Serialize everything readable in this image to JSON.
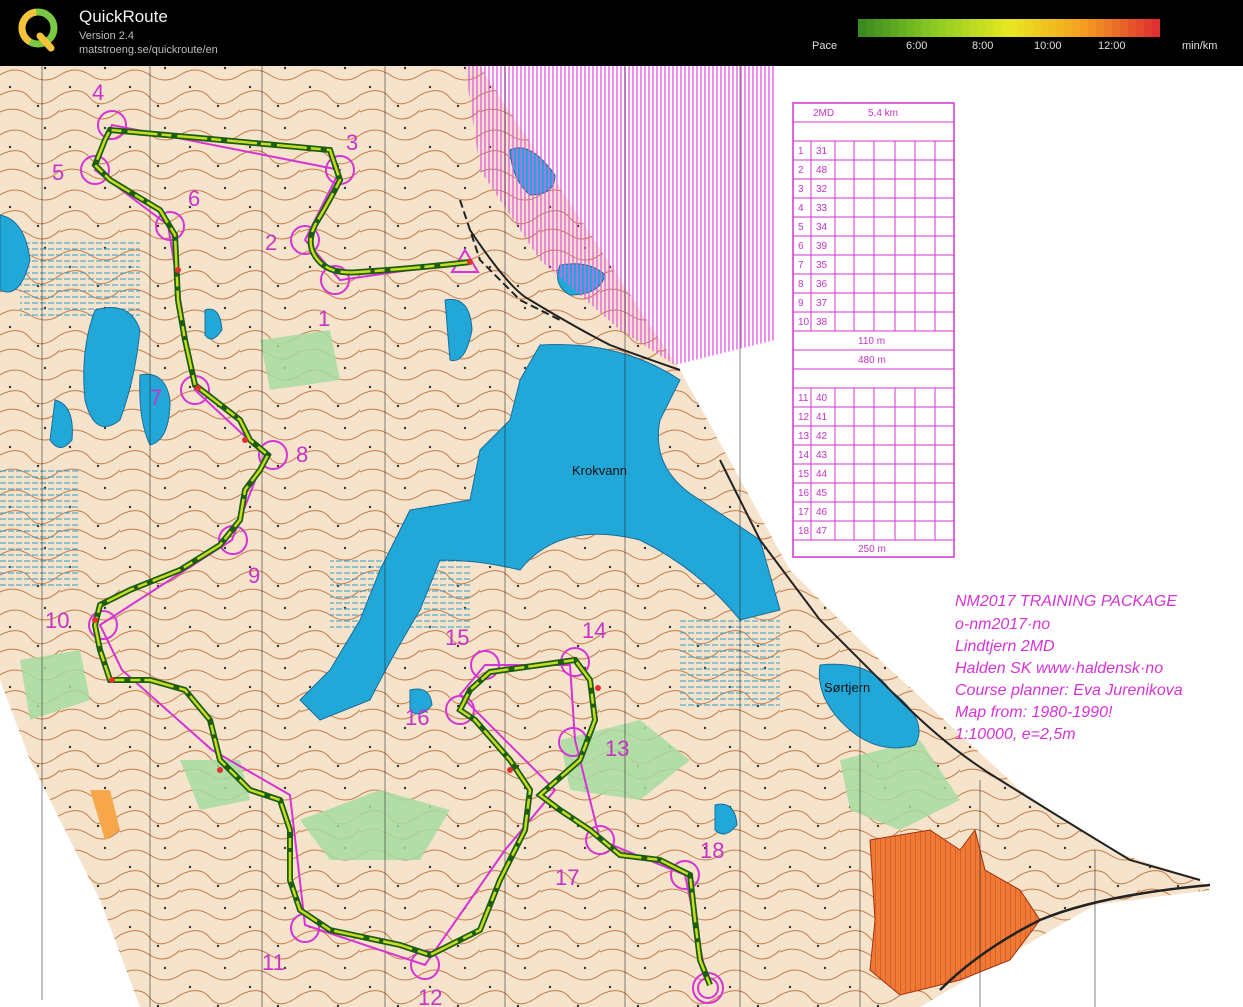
{
  "app": {
    "title": "QuickRoute",
    "version": "Version 2.4",
    "url": "matstroeng.se/quickroute/en"
  },
  "pace_scale": {
    "label": "Pace",
    "ticks": [
      "6:00",
      "8:00",
      "10:00",
      "12:00"
    ],
    "unit": "min/km",
    "colors": [
      "#3a8a1f",
      "#8ccc22",
      "#e8e820",
      "#f5a020",
      "#e03030"
    ]
  },
  "map": {
    "place_names": [
      "Krokvann",
      "Sørtjern"
    ],
    "info_text": [
      "NM2017 TRAINING PACKAGE",
      "o-nm2017·no",
      "Lindtjern 2MD",
      "Halden SK www·haldensk·no",
      "Course planner: Eva Jurenikova",
      "Map from: 1980-1990!",
      "1:10000, e=2,5m"
    ],
    "control_numbers": [
      "1",
      "2",
      "3",
      "4",
      "5",
      "6",
      "7",
      "8",
      "9",
      "10",
      "11",
      "12",
      "13",
      "14",
      "15",
      "16",
      "17",
      "18"
    ],
    "colors": {
      "course": "#d633d6",
      "water": "#1fa8d6",
      "terrain": "#f7e7d3",
      "contour": "#c0703a",
      "vegetation": "#9fdc9f",
      "route": "#4a9a1e"
    }
  },
  "description_sheet": {
    "header": [
      "2MD",
      "5,4 km"
    ],
    "rows_a": [
      [
        "1",
        "31"
      ],
      [
        "2",
        "48"
      ],
      [
        "3",
        "32"
      ],
      [
        "4",
        "33"
      ],
      [
        "5",
        "34"
      ],
      [
        "6",
        "39"
      ],
      [
        "7",
        "35"
      ],
      [
        "8",
        "36"
      ],
      [
        "9",
        "37"
      ],
      [
        "10",
        "38"
      ]
    ],
    "marked_1": "110 m",
    "marked_2": "480 m",
    "rows_b": [
      [
        "11",
        "40"
      ],
      [
        "12",
        "41"
      ],
      [
        "13",
        "42"
      ],
      [
        "14",
        "43"
      ],
      [
        "15",
        "44"
      ],
      [
        "16",
        "45"
      ],
      [
        "17",
        "46"
      ],
      [
        "18",
        "47"
      ]
    ],
    "finish": "250 m"
  }
}
